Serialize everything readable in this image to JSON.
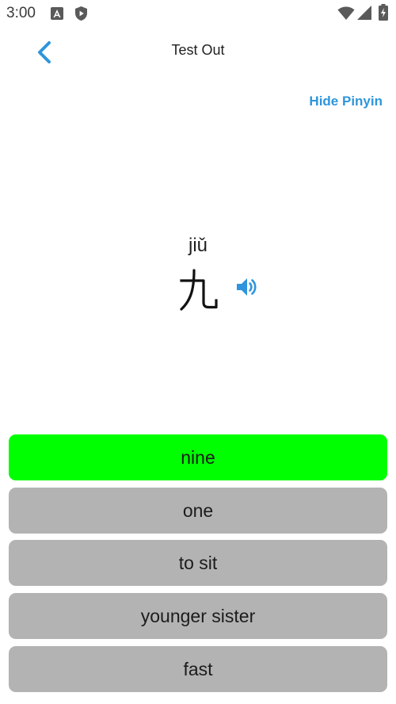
{
  "status_bar": {
    "time": "3:00",
    "icons": [
      "android-studio-icon",
      "shield-play-icon",
      "wifi-icon",
      "cellular-signal-icon",
      "battery-charging-icon"
    ]
  },
  "app_bar": {
    "title": "Test Out",
    "back_icon": "chevron-left-icon"
  },
  "toggle": {
    "label": "Hide Pinyin"
  },
  "prompt": {
    "pinyin": "jiǔ",
    "hanzi": "九",
    "audio_icon": "speaker-icon"
  },
  "answers": [
    {
      "label": "nine",
      "state": "correct"
    },
    {
      "label": "one",
      "state": "default"
    },
    {
      "label": "to sit",
      "state": "default"
    },
    {
      "label": "younger sister",
      "state": "default"
    },
    {
      "label": "fast",
      "state": "default"
    }
  ],
  "colors": {
    "accent": "#2f95dc",
    "correct": "#00ff00",
    "option": "#b3b3b3"
  }
}
